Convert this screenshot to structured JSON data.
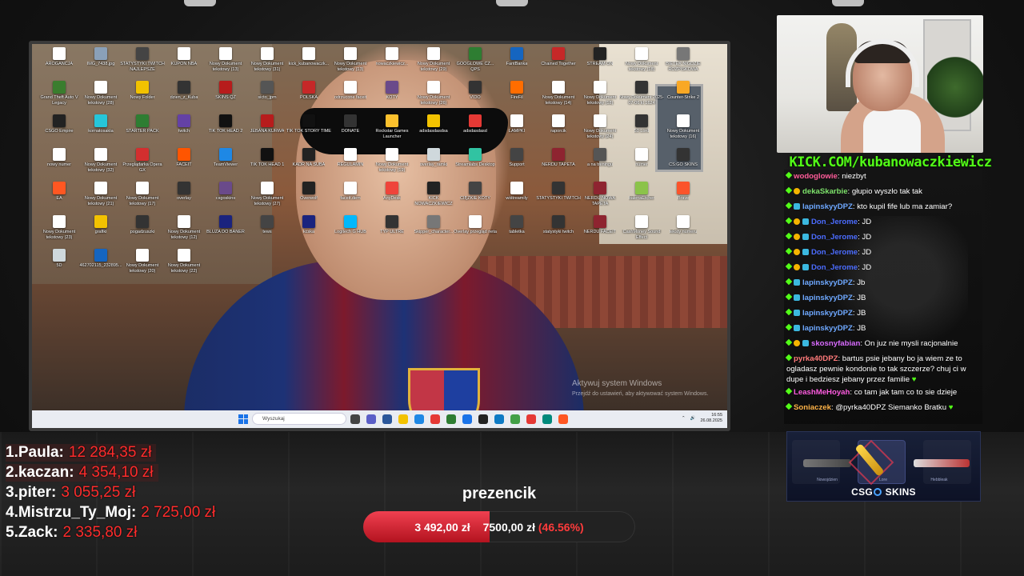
{
  "screen": {
    "desktop_icons": [
      {
        "label": "AROGANCJA",
        "color": "#ffffff"
      },
      {
        "label": "IMG_7438.jpg",
        "color": "#8aa0b8"
      },
      {
        "label": "STATYSTYKI TWITCH NAJLEPSZE",
        "color": "#444444"
      },
      {
        "label": "KUPON NBA",
        "color": "#ffffff"
      },
      {
        "label": "Nowy Dokument tekstowy (13)",
        "color": "#ffffff"
      },
      {
        "label": "Nowy Dokument tekstowy (31)",
        "color": "#ffffff"
      },
      {
        "label": "kick_kubanowaczk...",
        "color": "#ffffff"
      },
      {
        "label": "Nowy Dokument tekstowy (13)",
        "color": "#ffffff"
      },
      {
        "label": "nowaczkiewicz...",
        "color": "#ffffff"
      },
      {
        "label": "Nowy Dokument tekstowy (29)",
        "color": "#ffffff"
      },
      {
        "label": "GOOGLOWE CZ... QPS",
        "color": "#2e7d32"
      },
      {
        "label": "FantBanka",
        "color": "#1565c0"
      },
      {
        "label": "Chained Together",
        "color": "#c62828"
      },
      {
        "label": "STREAM ON",
        "color": "#222222"
      },
      {
        "label": "Nowy Dokument tekstowy (18)",
        "color": "#ffffff"
      },
      {
        "label": "BIETEK NIGDZIE ROZPISKOWA",
        "color": "#777777"
      },
      {
        "label": "Grand Theft Auto V Legacy",
        "color": "#3a7d2e"
      },
      {
        "label": "Nowy Dokument tekstowy (28)",
        "color": "#ffffff"
      },
      {
        "label": "Nowy Folder",
        "color": "#f2c200"
      },
      {
        "label": "dzien_z_Kuba",
        "color": "#333333"
      },
      {
        "label": "SKINS QZ",
        "color": "#b71c1c"
      },
      {
        "label": "sicto_jpm",
        "color": "#555555"
      },
      {
        "label": "POLSKA",
        "color": "#c62828"
      },
      {
        "label": "odrzucone faceit",
        "color": "#ffffff"
      },
      {
        "label": "KOTY",
        "color": "#6a4a8a"
      },
      {
        "label": "Nowy Dokument tekstowy (26)",
        "color": "#ffffff"
      },
      {
        "label": "VIDO",
        "color": "#333333"
      },
      {
        "label": "FireFil",
        "color": "#ff6d00"
      },
      {
        "label": "Nowy Dokument tekstowy (14)",
        "color": "#ffffff"
      },
      {
        "label": "Nowy Dokument tekstowy (18)",
        "color": "#ffffff"
      },
      {
        "label": "Nowy Dokument 2025-07-06 kl 1624",
        "color": "#333333"
      },
      {
        "label": "Counter-Strike 2",
        "color": "#f9a825"
      },
      {
        "label": "CSGO Empire",
        "color": "#222222"
      },
      {
        "label": "kornatosakta",
        "color": "#26c6da"
      },
      {
        "label": "STARTER PACK",
        "color": "#2e7d32"
      },
      {
        "label": "twitch",
        "color": "#6441a5"
      },
      {
        "label": "TIK TOK HEAD 2",
        "color": "#111111"
      },
      {
        "label": "JEBANA KURWA",
        "color": "#b71c1c"
      },
      {
        "label": "TIK TOK STORY TIME",
        "color": "#111111"
      },
      {
        "label": "DONATE",
        "color": "#333333"
      },
      {
        "label": "Rockstar Games Launcher",
        "color": "#fbc02d"
      },
      {
        "label": "adsdasdasdsa",
        "color": "#f2c200"
      },
      {
        "label": "adsdasdasd",
        "color": "#e53935"
      },
      {
        "label": "LAMPKI",
        "color": "#ffffff"
      },
      {
        "label": "raporcik",
        "color": "#ffffff"
      },
      {
        "label": "Nowy Dokument tekstowy (24)",
        "color": "#ffffff"
      },
      {
        "label": "50 Lord",
        "color": "#333333"
      },
      {
        "label": "Nowy Dokument tekstowy (16)",
        "color": "#ffffff"
      },
      {
        "label": "nowy numer",
        "color": "#ffffff"
      },
      {
        "label": "Nowy Dokument tekstowy (32)",
        "color": "#ffffff"
      },
      {
        "label": "Przeglądarka Opera GX",
        "color": "#d32f2f"
      },
      {
        "label": "FACEIT",
        "color": "#ff5500"
      },
      {
        "label": "TeamViewer",
        "color": "#1e88e5"
      },
      {
        "label": "TIK TOK HEAD 1",
        "color": "#111111"
      },
      {
        "label": "KADR NA SUBA",
        "color": "#222222"
      },
      {
        "label": "REGULAMIN",
        "color": "#ffffff"
      },
      {
        "label": "Nowy Dokument tekstowy (19)",
        "color": "#ffffff"
      },
      {
        "label": "overlay_ramki",
        "color": "#cfd8dc"
      },
      {
        "label": "Streamlabs Desktop",
        "color": "#31c3a2"
      },
      {
        "label": "Support",
        "color": "#444444"
      },
      {
        "label": "NERDU TAPETA",
        "color": "#8e2430"
      },
      {
        "label": "a na treningu",
        "color": "#555555"
      },
      {
        "label": "numer",
        "color": "#ffffff"
      },
      {
        "label": "CS:GO SKINS",
        "color": "#333333"
      },
      {
        "label": "EA",
        "color": "#ff5722"
      },
      {
        "label": "Nowy Dokument tekstowy (21)",
        "color": "#ffffff"
      },
      {
        "label": "Nowy Dokument tekstowy (17)",
        "color": "#ffffff"
      },
      {
        "label": "overlay",
        "color": "#333333"
      },
      {
        "label": "csgoskins",
        "color": "#6a4a8a"
      },
      {
        "label": "Nowy Dokument tekstowy (27)",
        "color": "#ffffff"
      },
      {
        "label": "Overwolf",
        "color": "#222222"
      },
      {
        "label": "faceit.dem",
        "color": "#ffffff"
      },
      {
        "label": "AnyDesk",
        "color": "#ef443b"
      },
      {
        "label": "KICK NOWACZKIEWICZ",
        "color": "#222222"
      },
      {
        "label": "CIĘŻKIE KOTY",
        "color": "#444444"
      },
      {
        "label": "wiśtreamily",
        "color": "#ffffff"
      },
      {
        "label": "STATYSTYKI TWITCH",
        "color": "#333333"
      },
      {
        "label": "NERDU NOWA TAPETA",
        "color": "#8e2430"
      },
      {
        "label": "balenaEtcher",
        "color": "#8bc34a"
      },
      {
        "label": "Brave",
        "color": "#fb542b"
      },
      {
        "label": "Nowy Dokument tekstowy (23)",
        "color": "#ffffff"
      },
      {
        "label": "grafiki",
        "color": "#f2c200"
      },
      {
        "label": "pogadzuszki",
        "color": "#333333"
      },
      {
        "label": "Nowy Dokument tekstowy (12)",
        "color": "#ffffff"
      },
      {
        "label": "BLUZA DO BANER",
        "color": "#1a237e"
      },
      {
        "label": "tews",
        "color": "#444444"
      },
      {
        "label": "kcska",
        "color": "#1a237e"
      },
      {
        "label": "Logitech G HUB",
        "color": "#00b8fc"
      },
      {
        "label": "TYP ULTRE",
        "color": "#333333"
      },
      {
        "label": "Skipper_character...",
        "color": "#777777"
      },
      {
        "label": "Overlay przegląd neta",
        "color": "#ffffff"
      },
      {
        "label": "tabletka",
        "color": "#444444"
      },
      {
        "label": "statystyki twitch",
        "color": "#333333"
      },
      {
        "label": "NERDU FACEIT",
        "color": "#8e2430"
      },
      {
        "label": "CashMoney Sound Effect",
        "color": "#ffffff"
      },
      {
        "label": "teksty numeru",
        "color": "#ffffff"
      },
      {
        "label": "5D",
        "color": "#cfd8dc"
      },
      {
        "label": "462702115_232895...",
        "color": "#1565c0"
      },
      {
        "label": "Nowy Dokument tekstowy (20)",
        "color": "#ffffff"
      },
      {
        "label": "Nowy Dokument tekstowy (22)",
        "color": "#ffffff"
      }
    ],
    "activate_windows": {
      "line1": "Aktywuj system Windows",
      "line2": "Przejdź do ustawień, aby aktywować system Windows."
    },
    "taskbar": {
      "search_placeholder": "Wyszukaj",
      "time": "16:55",
      "date": "26.08.2025",
      "apps": [
        "#444444",
        "#5b5fc7",
        "#2b579a",
        "#f2c200",
        "#1e88e5",
        "#e53935",
        "#2e7d32",
        "#1a73e8",
        "#222222",
        "#0e7ac4",
        "#43a047",
        "#e53935",
        "#00897b",
        "#ff5722"
      ]
    }
  },
  "kick_url": "KICK.COM/kubanowaczkiewicz",
  "chat": [
    {
      "user": "wodoglowie",
      "user_color": "#ff5c9a",
      "text": ": niezbyt",
      "badges": []
    },
    {
      "user": "dekaSkarbie",
      "user_color": "#7ee36b",
      "text": ": głupio wyszło tak tak",
      "badges": [
        "b1"
      ]
    },
    {
      "user": "lapinskyyDPZ",
      "user_color": "#6ea8ff",
      "text": ": kto kupil fife lub ma zamiar?",
      "badges": [
        "b2"
      ]
    },
    {
      "user": "Don_Jerome",
      "user_color": "#4b6cff",
      "text": ": JD",
      "badges": [
        "b1",
        "b2"
      ]
    },
    {
      "user": "Don_Jerome",
      "user_color": "#4b6cff",
      "text": ": JD",
      "badges": [
        "b1",
        "b2"
      ]
    },
    {
      "user": "Don_Jerome",
      "user_color": "#4b6cff",
      "text": ": JD",
      "badges": [
        "b1",
        "b2"
      ]
    },
    {
      "user": "Don_Jerome",
      "user_color": "#4b6cff",
      "text": ": JD",
      "badges": [
        "b1",
        "b2"
      ]
    },
    {
      "user": "lapinskyyDPZ",
      "user_color": "#6ea8ff",
      "text": ": Jb",
      "badges": [
        "b2"
      ]
    },
    {
      "user": "lapinskyyDPZ",
      "user_color": "#6ea8ff",
      "text": ": JB",
      "badges": [
        "b2"
      ]
    },
    {
      "user": "lapinskyyDPZ",
      "user_color": "#6ea8ff",
      "text": ": JB",
      "badges": [
        "b2"
      ]
    },
    {
      "user": "lapinskyyDPZ",
      "user_color": "#6ea8ff",
      "text": ": JB",
      "badges": [
        "b2"
      ]
    },
    {
      "user": "skosnyfabian",
      "user_color": "#d96bff",
      "text": ": On juz nie mysli racjonalnie",
      "badges": [
        "b1",
        "b2"
      ]
    },
    {
      "user": "pyrka40DPZ",
      "user_color": "#ff7a7a",
      "text": ": bartus psie jebany bo ja wiem ze to ogladasz pewnie kondonie to tak szczerze? chuj ci w dupe i bedziesz jebany przez familie",
      "badges": [],
      "heart": true
    },
    {
      "user": "LeashMeHoyah",
      "user_color": "#ff5ce1",
      "text": ": co tam jak tam co to sie dzieje",
      "badges": []
    },
    {
      "user": "Soniaczek",
      "user_color": "#ffb347",
      "text": ": @pyrka40DPZ Siemanko Bratku",
      "badges": [],
      "heart": true
    }
  ],
  "skins_widget": {
    "brand": "CSGO SKINS",
    "labels": [
      "Nowojdzien",
      "Lore",
      "Hebbleak"
    ]
  },
  "leaderboard": [
    {
      "rank": "1.",
      "name": "Paula:",
      "amount": "12 284,35 zł"
    },
    {
      "rank": "2.",
      "name": "kaczan:",
      "amount": "4 354,10 zł"
    },
    {
      "rank": "3.",
      "name": "piter:",
      "amount": "3 055,25 zł"
    },
    {
      "rank": "4.",
      "name": "Mistrzu_Ty_Moj:",
      "amount": "2 725,00 zł"
    },
    {
      "rank": "5.",
      "name": "Zack:",
      "amount": "2 335,80 zł"
    }
  ],
  "goal": {
    "title": "prezencik",
    "current": "3 492,00 zł",
    "target": "7500,00 zł",
    "percent_label": "(46.56%)",
    "percent": 46.56
  },
  "colors": {
    "kick_green": "#53fc18",
    "donation_red": "#ff2c2c"
  }
}
